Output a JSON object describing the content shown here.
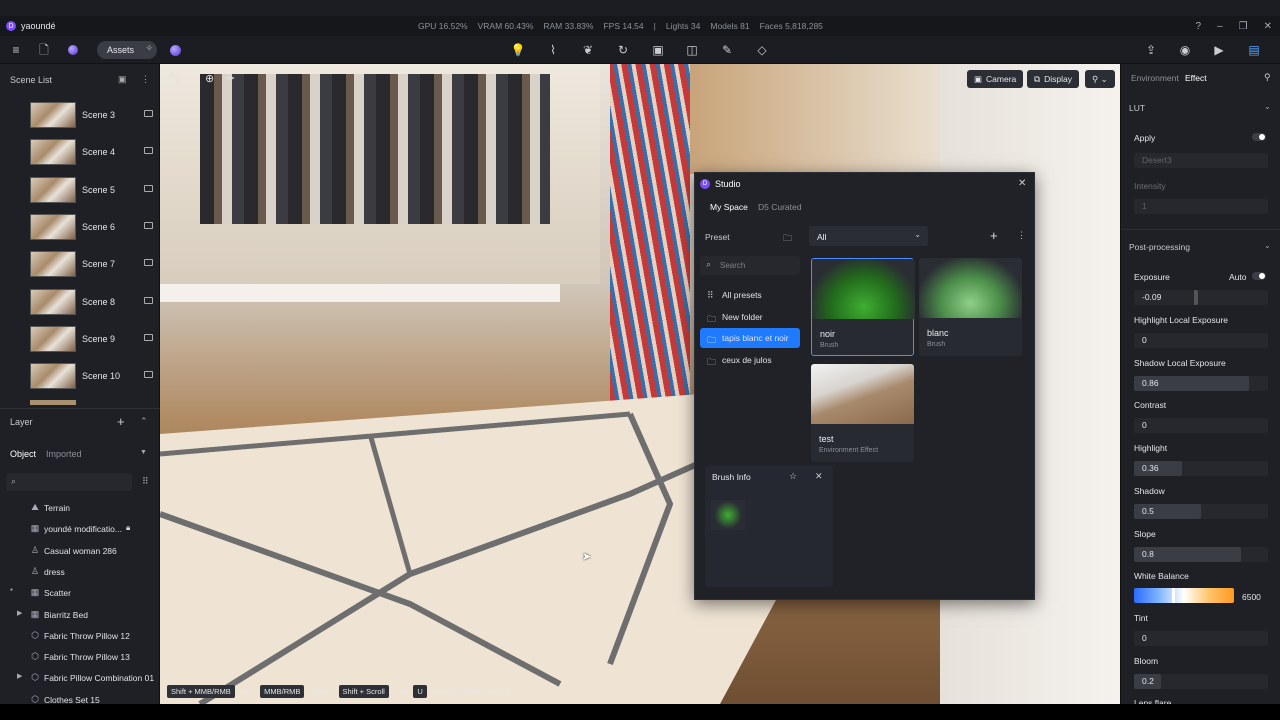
{
  "app": {
    "title": "yaoundé"
  },
  "stats": {
    "gpu": "GPU 16.52%",
    "vram": "VRAM 60.43%",
    "ram": "RAM 33.83%",
    "fps": "FPS 14.54",
    "sep": "|",
    "lights": "Lights 34",
    "models": "Models 81",
    "faces": "Faces 5,818,285"
  },
  "toolbar": {
    "assets": "Assets"
  },
  "scene_list": {
    "title": "Scene List",
    "scenes": [
      "Scene 3",
      "Scene 4",
      "Scene 5",
      "Scene 6",
      "Scene 7",
      "Scene 8",
      "Scene 9",
      "Scene 10"
    ]
  },
  "layer": {
    "title": "Layer",
    "tabs": [
      "Object",
      "Imported"
    ],
    "items": [
      "Terrain",
      "youndé modificatio...",
      "Casual woman 286",
      "dress",
      "Scatter",
      "Biarritz Bed",
      "Fabric Throw Pillow 12",
      "Fabric Throw Pillow 13",
      "Fabric Pillow Combination 01",
      "Clothes Set 15"
    ]
  },
  "viewport": {
    "camera": "Camera",
    "display": "Display",
    "hints": [
      {
        "key": "Shift + MMB/RMB",
        "action": "Pan"
      },
      {
        "key": "MMB/RMB",
        "action": "Rotate"
      },
      {
        "key": "Shift + Scroll",
        "action": "Fov"
      },
      {
        "key": "U",
        "action": "Random Placement Off"
      }
    ]
  },
  "studio": {
    "title": "Studio",
    "tabs": [
      "My Space",
      "D5 Curated"
    ],
    "preset_label": "Preset",
    "filter": "All",
    "search_placeholder": "Search",
    "folders": [
      "All presets",
      "New folder",
      "tapis blanc et noir",
      "ceux de julos"
    ],
    "cards": [
      {
        "title": "noir",
        "subtitle": "Brush"
      },
      {
        "title": "blanc",
        "subtitle": "Brush"
      },
      {
        "title": "test",
        "subtitle": "Environment Effect"
      }
    ],
    "brush_info": "Brush Info"
  },
  "right": {
    "tabs": [
      "Environment",
      "Effect"
    ],
    "lut": "LUT",
    "apply": "Apply",
    "lut_value": "Desert3",
    "intensity": "Intensity",
    "intensity_value": "1",
    "post": "Post-processing",
    "exposure": "Exposure",
    "auto": "Auto",
    "exposure_value": "-0.09",
    "params": [
      {
        "label": "Highlight Local Exposure",
        "value": "0",
        "fill": 0
      },
      {
        "label": "Shadow Local Exposure",
        "value": "0.86",
        "fill": 0.86
      },
      {
        "label": "Contrast",
        "value": "0",
        "fill": 0
      },
      {
        "label": "Highlight",
        "value": "0.36",
        "fill": 0.36
      },
      {
        "label": "Shadow",
        "value": "0.5",
        "fill": 0.5
      },
      {
        "label": "Slope",
        "value": "0.8",
        "fill": 0.8
      }
    ],
    "white_balance": "White Balance",
    "wb_value": "6500",
    "tint": "Tint",
    "tint_value": "0",
    "bloom": "Bloom",
    "bloom_value": "0.2",
    "lens": "Lens flare"
  }
}
